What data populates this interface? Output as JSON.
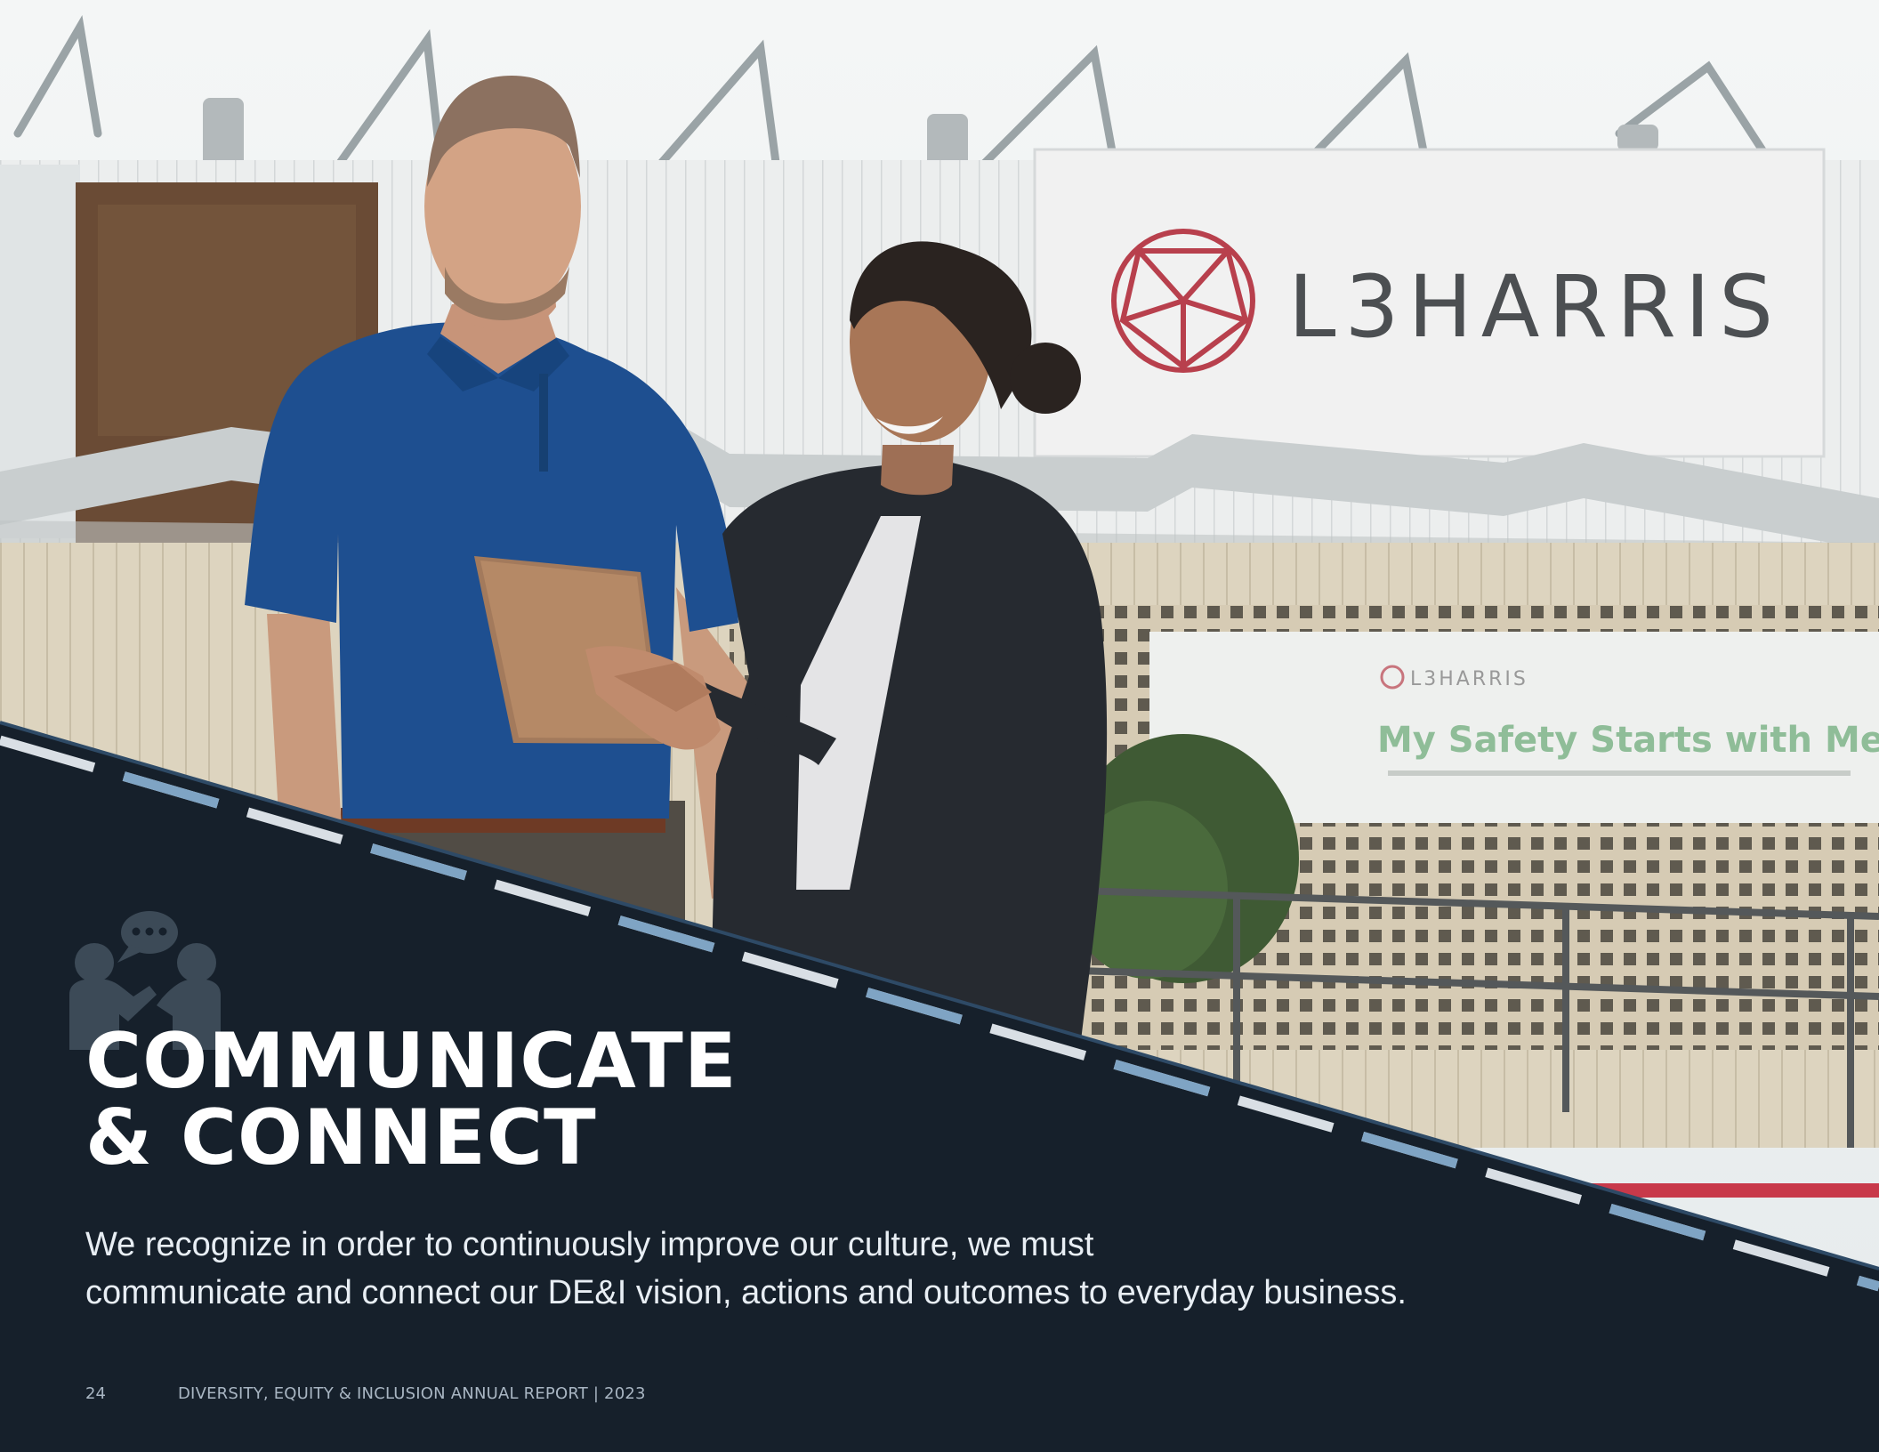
{
  "photo": {
    "sign_logo_text": "L3HARRIS",
    "banner_logo_text": "L3HARRIS",
    "banner_slogan": "My Safety Starts with Me"
  },
  "section": {
    "icon": "people-conversation-icon",
    "title_line1": "COMMUNICATE",
    "title_line2": "& CONNECT",
    "intro_line1": "We recognize in order to continuously improve our culture, we must",
    "intro_line2": "communicate and connect our DE&I vision, actions and outcomes to everyday business."
  },
  "footer": {
    "page_number": "24",
    "report_title": "DIVERSITY, EQUITY & INCLUSION ANNUAL REPORT | 2023"
  },
  "colors": {
    "navy_panel": "#16202b",
    "stripe_light": "#d9dfe5",
    "stripe_blue": "#7fa4c4",
    "brand_red": "#b8404d"
  }
}
